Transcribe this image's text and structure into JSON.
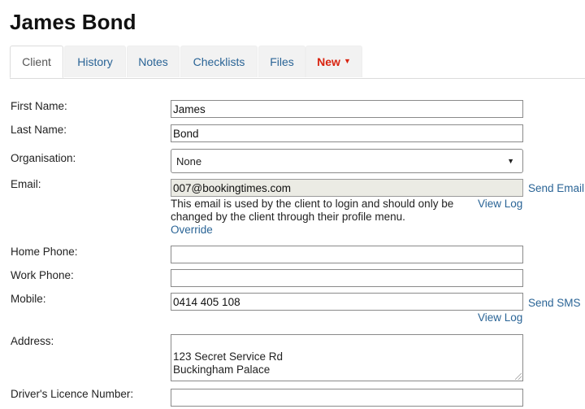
{
  "page": {
    "title": "James Bond"
  },
  "tabs": [
    {
      "label": "Client"
    },
    {
      "label": "History"
    },
    {
      "label": "Notes"
    },
    {
      "label": "Checklists"
    },
    {
      "label": "Files"
    },
    {
      "label": "New",
      "icon": "caret-down-icon"
    }
  ],
  "form": {
    "first_name": {
      "label": "First Name:",
      "value": "James"
    },
    "last_name": {
      "label": "Last Name:",
      "value": "Bond"
    },
    "organisation": {
      "label": "Organisation:",
      "value": "None"
    },
    "email": {
      "label": "Email:",
      "value": "007@bookingtimes.com",
      "help": "This email is used by the client to login and should only be changed by the client through their profile menu.",
      "override": "Override",
      "send": "Send Email",
      "view_log": "View Log"
    },
    "home_phone": {
      "label": "Home Phone:",
      "value": ""
    },
    "work_phone": {
      "label": "Work Phone:",
      "value": ""
    },
    "mobile": {
      "label": "Mobile:",
      "value": "0414 405 108",
      "send": "Send SMS",
      "view_log": "View Log"
    },
    "address": {
      "label": "Address:",
      "value": "123 Secret Service Rd\nBuckingham Palace"
    },
    "licence": {
      "label": "Driver's Licence Number:",
      "value": ""
    }
  },
  "colors": {
    "link": "#2a6496",
    "new_tab": "#d9230f",
    "readonly_bg": "#ebebe4"
  }
}
